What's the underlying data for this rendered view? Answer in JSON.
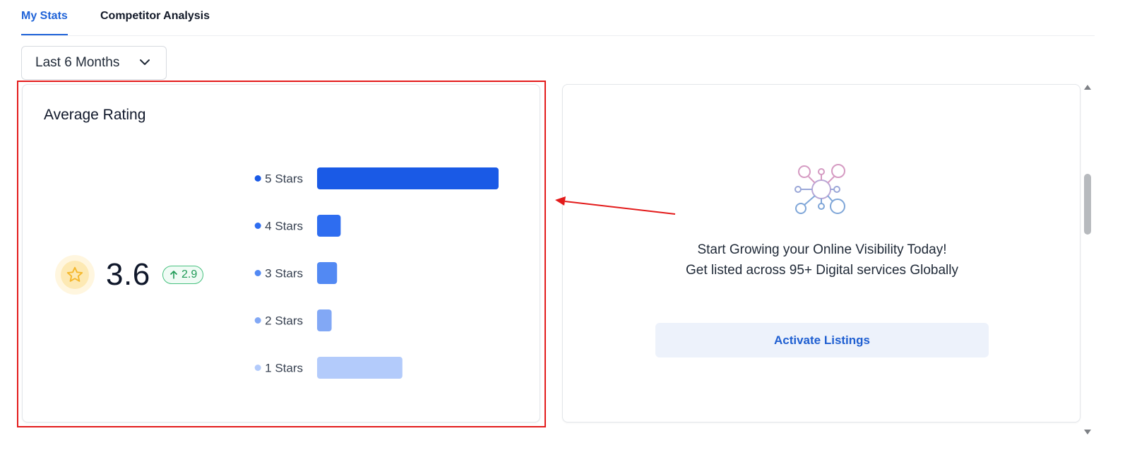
{
  "tabs": [
    {
      "label": "My Stats",
      "active": true
    },
    {
      "label": "Competitor Analysis",
      "active": false
    }
  ],
  "period_select": {
    "value": "Last 6 Months",
    "icon": "chevron-down-icon"
  },
  "rating_card": {
    "title": "Average Rating",
    "value": "3.6",
    "delta": "2.9",
    "delta_icon": "arrow-up-icon",
    "rating_icon": "star-icon"
  },
  "chart_data": {
    "type": "bar",
    "orientation": "horizontal",
    "categories": [
      "5 Stars",
      "4 Stars",
      "3 Stars",
      "2 Stars",
      "1 Stars"
    ],
    "values": [
      100,
      13,
      11,
      8,
      47
    ],
    "value_unit": "relative share (percent of largest bar, estimated)",
    "colors": [
      "#1a5ae6",
      "#2e6df0",
      "#5289f3",
      "#82a8f5",
      "#b3cbfb"
    ],
    "legend_position": "left",
    "grid": false
  },
  "promo_card": {
    "illustration_icon": "network-nodes-icon",
    "line1": "Start Growing your Online Visibility Today!",
    "line2": "Get listed across 95+ Digital services Globally",
    "button_label": "Activate Listings"
  },
  "colors": {
    "accent": "#1f63d8",
    "highlight": "#e31b1b",
    "delta_green": "#1f9a56",
    "star": "#f5b82e"
  }
}
